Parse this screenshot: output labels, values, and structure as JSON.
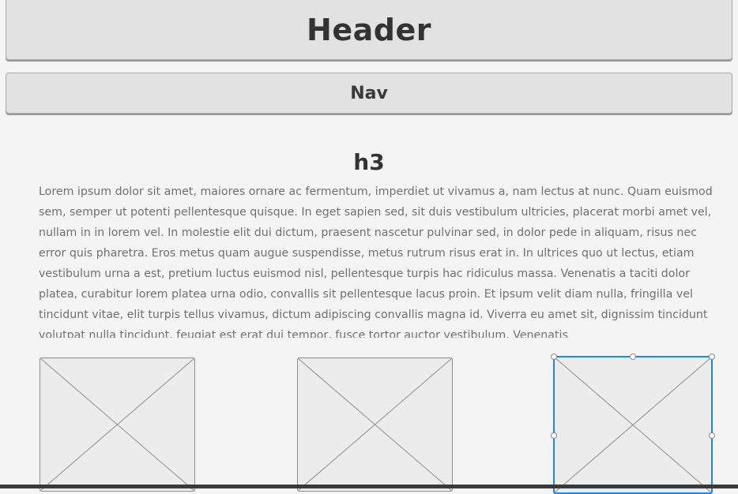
{
  "header": {
    "label": "Header"
  },
  "nav": {
    "label": "Nav"
  },
  "content": {
    "heading": "h3",
    "paragraph": "Lorem ipsum dolor sit amet, maiores ornare ac fermentum, imperdiet ut vivamus a, nam lectus at nunc. Quam euismod sem, semper ut potenti pellentesque quisque. In eget sapien sed, sit duis vestibulum ultricies, placerat morbi amet vel, nullam in in lorem vel. In molestie elit dui dictum, praesent nascetur pulvinar sed, in dolor pede in aliquam, risus nec error quis pharetra. Eros metus quam augue suspendisse, metus rutrum risus erat in.  In ultrices quo ut lectus, etiam vestibulum urna a est, pretium luctus euismod nisl, pellentesque turpis hac ridiculus massa. Venenatis a taciti dolor platea, curabitur lorem platea urna odio, convallis sit pellentesque lacus proin. Et ipsum velit diam nulla, fringilla vel tincidunt vitae, elit turpis tellus vivamus, dictum adipiscing convallis magna id. Viverra eu amet sit, dignissim tincidunt volutpat nulla tincidunt, feugiat est erat dui tempor, fusce tortor auctor vestibulum. Venenatis"
  },
  "placeholders": [
    {
      "icon": "image-placeholder-icon",
      "selected": false
    },
    {
      "icon": "image-placeholder-icon",
      "selected": false
    },
    {
      "icon": "image-placeholder-icon",
      "selected": true
    }
  ],
  "colors": {
    "selection": "#1e88e5",
    "box_fill": "#e2e2e2",
    "page_bg": "#f4f4f4"
  }
}
